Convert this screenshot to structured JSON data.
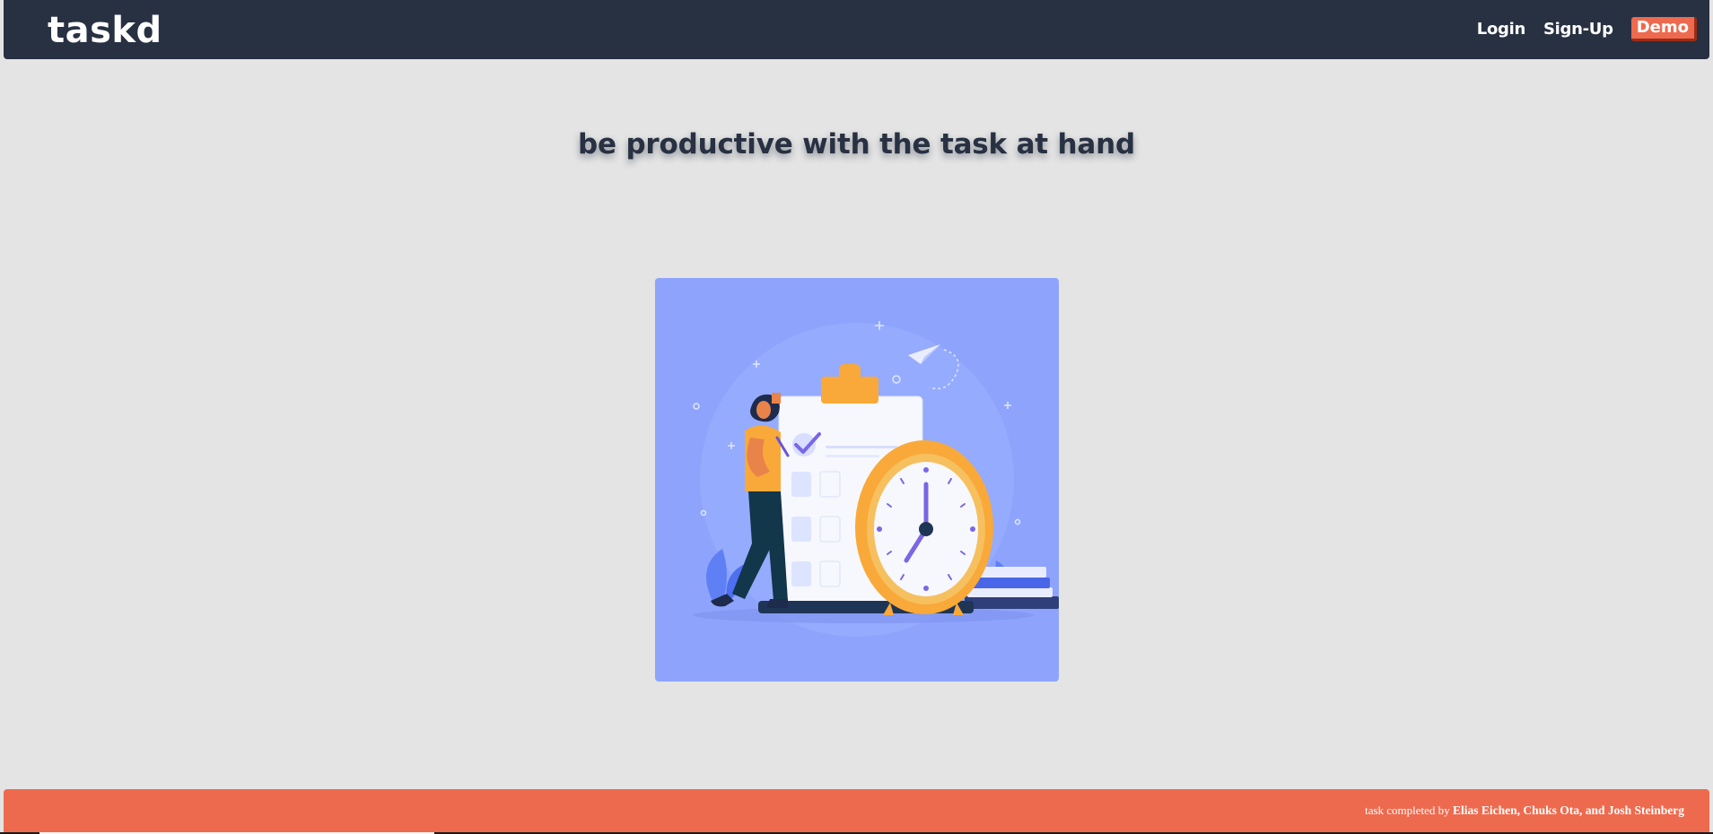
{
  "header": {
    "logo": "taskd",
    "nav": {
      "login": "Login",
      "signup": "Sign-Up",
      "demo": "Demo"
    }
  },
  "main": {
    "tagline": "be productive with the task at hand"
  },
  "footer": {
    "prefix": "task completed by",
    "authors": "Elias Eichen, Chuks Ota, and Josh Steinberg"
  },
  "colors": {
    "header_bg": "#283142",
    "accent": "#ee6a4e",
    "page_bg": "#e4e4e4",
    "hero_bg": "#8ea4fc"
  },
  "icons": {
    "hero": "task-clock-illustration"
  }
}
